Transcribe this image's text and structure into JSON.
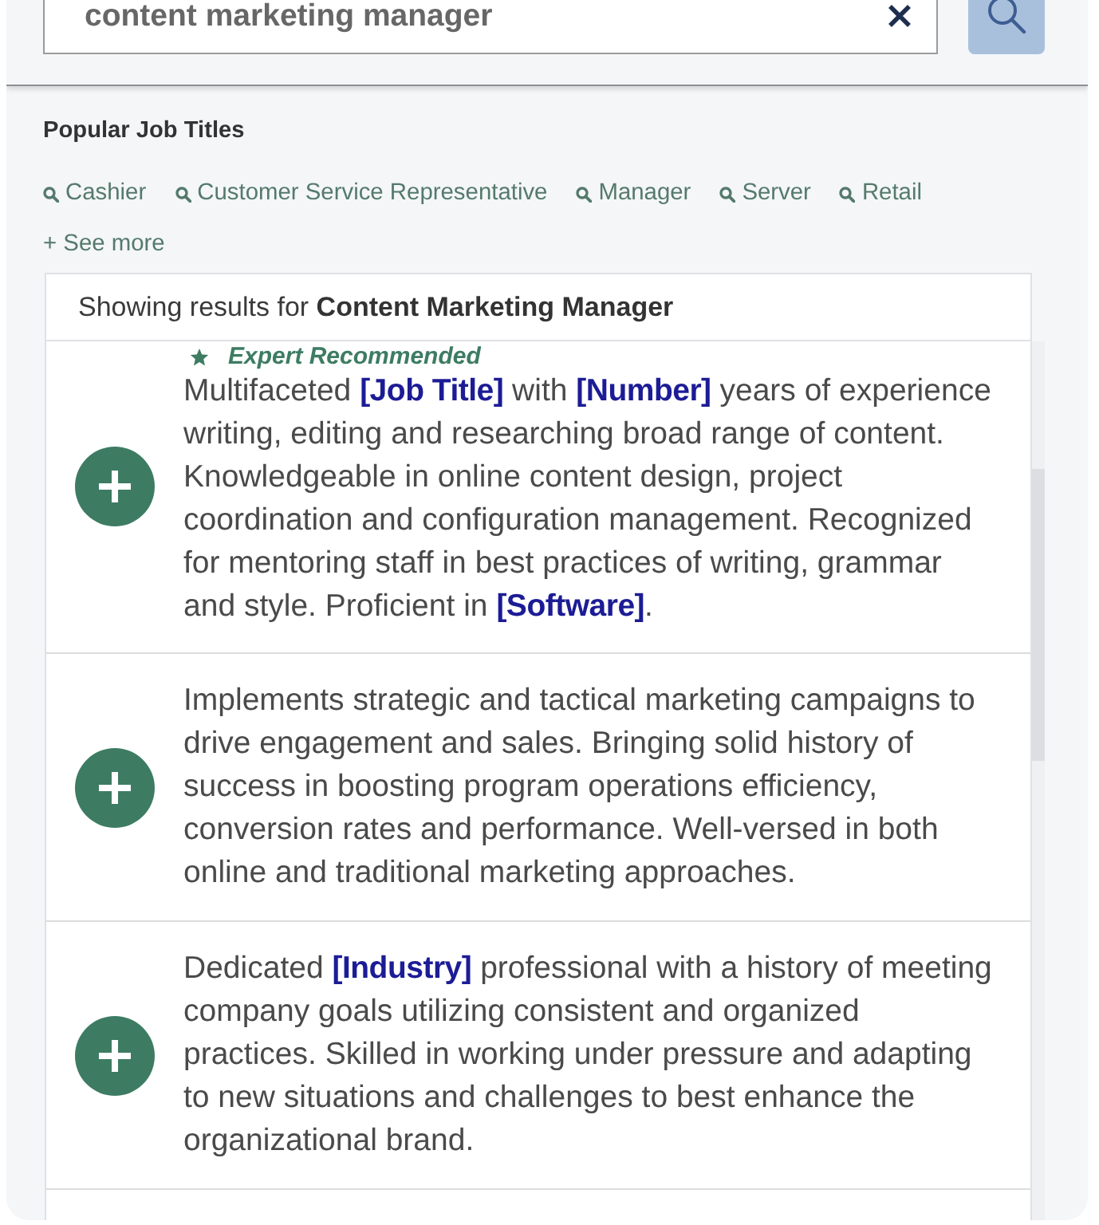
{
  "search": {
    "value": "content marketing manager"
  },
  "popular_job_titles": {
    "title": "Popular Job Titles",
    "items": [
      {
        "label": "Cashier"
      },
      {
        "label": "Customer Service Representative"
      },
      {
        "label": "Manager"
      },
      {
        "label": "Server"
      },
      {
        "label": "Retail"
      }
    ],
    "see_more": "+ See more"
  },
  "results": {
    "heading": "Showing results for **Content Marketing Manager**",
    "items": [
      {
        "badge": "Expert Recommended",
        "text": "Multifaceted **[Job Title]** with **[Number]** years of experience writing, editing and researching broad range of content. Knowledgeable in online content design, project coordination and configuration management. Recognized for mentoring staff in best practices of writing, grammar and style. Proficient in **[Software]**."
      },
      {
        "text": "Implements strategic and tactical marketing campaigns to drive engagement and sales. Bringing solid history of success in boosting program operations efficiency, conversion rates and performance. Well-versed in both online and traditional marketing approaches."
      },
      {
        "text": "Dedicated **[Industry]** professional with a history of meeting company goals utilizing consistent and organized practices. Skilled in working under pressure and adapting to new situations and challenges to best enhance the organizational brand."
      }
    ]
  }
}
